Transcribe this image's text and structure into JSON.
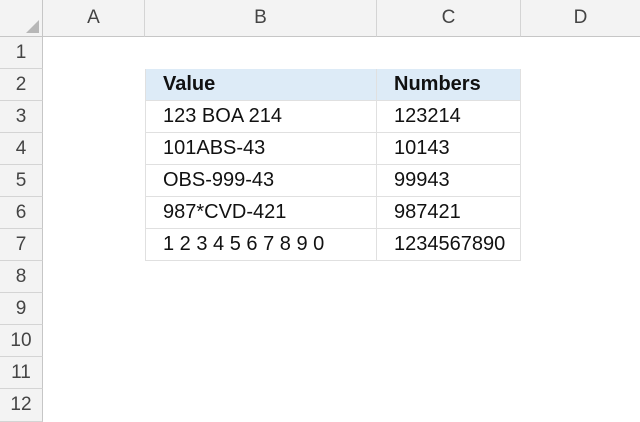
{
  "columns": [
    "A",
    "B",
    "C",
    "D"
  ],
  "rows": [
    "1",
    "2",
    "3",
    "4",
    "5",
    "6",
    "7",
    "8",
    "9",
    "10",
    "11",
    "12"
  ],
  "table": {
    "header": {
      "value": "Value",
      "numbers": "Numbers"
    },
    "data": [
      {
        "value": "123 BOA 214",
        "numbers": "123214"
      },
      {
        "value": "101ABS-43",
        "numbers": "10143"
      },
      {
        "value": "OBS-999-43",
        "numbers": "99943"
      },
      {
        "value": "987*CVD-421",
        "numbers": "987421"
      },
      {
        "value": "1 2 3 4 5 6 7 8 9 0",
        "numbers": "1234567890"
      }
    ]
  },
  "colors": {
    "header_fill": "#ddebf7",
    "grid_header": "#f3f3f3"
  }
}
